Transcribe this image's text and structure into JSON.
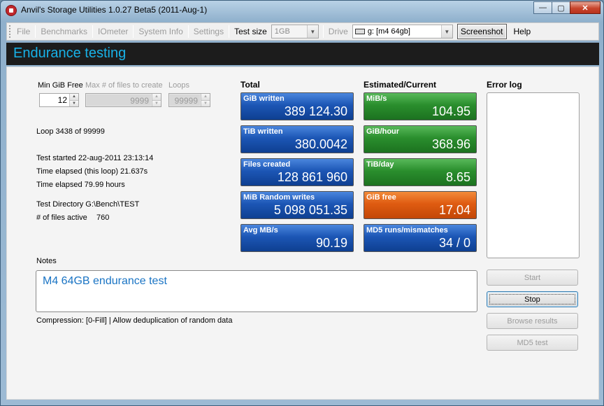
{
  "window": {
    "title": "Anvil's Storage Utilities 1.0.27 Beta5 (2011-Aug-1)",
    "minimize": "—",
    "maximize": "▢",
    "close": "✕"
  },
  "menu": {
    "file": "File",
    "benchmarks": "Benchmarks",
    "iometer": "IOmeter",
    "system_info": "System Info",
    "settings": "Settings",
    "test_size_label": "Test size",
    "test_size_value": "1GB",
    "drive_label": "Drive",
    "drive_value": "g: [m4 64gb]",
    "screenshot": "Screenshot",
    "help": "Help"
  },
  "header": {
    "title": "Endurance testing"
  },
  "params": {
    "min_gib_free_label": "Min GiB Free",
    "min_gib_free_value": "12",
    "max_files_label": "Max # of files to create",
    "max_files_value": "9999",
    "loops_label": "Loops",
    "loops_value": "99999"
  },
  "info": {
    "loop": "Loop 3438 of 99999",
    "test_started": "Test started 22-aug-2011 23:13:14",
    "elapsed_loop": "Time elapsed (this loop) 21.637s",
    "elapsed_total": "Time elapsed 79.99 hours",
    "test_directory": "Test Directory G:\\Bench\\TEST",
    "files_active_label": "# of files active",
    "files_active_value": "760"
  },
  "columns": {
    "total": "Total",
    "estimated": "Estimated/Current",
    "error_log": "Error log"
  },
  "total_tiles": [
    {
      "label": "GiB written",
      "value": "389 124.30"
    },
    {
      "label": "TiB written",
      "value": "380.0042"
    },
    {
      "label": "Files created",
      "value": "128 861 960"
    },
    {
      "label": "MiB Random writes",
      "value": "5 098 051.35"
    },
    {
      "label": "Avg MB/s",
      "value": "90.19"
    }
  ],
  "estimated_tiles": [
    {
      "label": "MiB/s",
      "value": "104.95"
    },
    {
      "label": "GiB/hour",
      "value": "368.96"
    },
    {
      "label": "TiB/day",
      "value": "8.65"
    },
    {
      "label": "GiB free",
      "value": "17.04"
    },
    {
      "label": "MD5 runs/mismatches",
      "value": "34 / 0"
    }
  ],
  "notes": {
    "label": "Notes",
    "text": "M4 64GB endurance test"
  },
  "compression": "Compression: [0-Fill]  |  Allow deduplication of random data",
  "buttons": {
    "start": "Start",
    "stop": "Stop",
    "browse": "Browse results",
    "md5": "MD5 test"
  },
  "colors": {
    "tile_blue": "#1c56b5",
    "tile_green": "#2a8e2d",
    "tile_orange": "#df5b11",
    "header_text": "#18b2e8",
    "notes_text": "#1a74c4"
  }
}
